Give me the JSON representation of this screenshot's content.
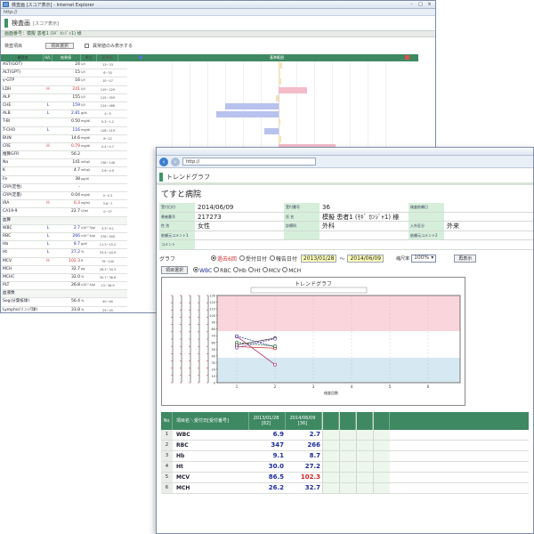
{
  "win1": {
    "title": "検査画 [スコア表示] - Internet Explorer",
    "address": "http://",
    "header_title": "検査画",
    "header_sub": "[スコア表示]",
    "patient_line": "画面番号：模擬 患者1 (ﾓｷﾞ ｶﾝｼﾞｬ1) 様",
    "filter_label": "検査項目",
    "filter_button": "項目選択",
    "checkbox_label": "異常値のみ表示する",
    "columns": [
      "項目名",
      "H/L",
      "結果値",
      "単位",
      "基準値"
    ],
    "scale_label": "基準範囲",
    "rows": [
      {
        "name": "AST(GOT)",
        "hl": "",
        "val": "24",
        "unit": "U/l",
        "ref": "13~33"
      },
      {
        "name": "ALT(GPT)",
        "hl": "",
        "val": "15",
        "unit": "U/l",
        "ref": "6~30"
      },
      {
        "name": "γ-GTP",
        "hl": "",
        "val": "16",
        "unit": "U/l",
        "ref": "10~47"
      },
      {
        "name": "LDH",
        "hl": "H",
        "val": "241",
        "unit": "U/l",
        "ref": "119~229"
      },
      {
        "name": "ALP",
        "hl": "",
        "val": "155",
        "unit": "U/l",
        "ref": "115~359"
      },
      {
        "name": "CHE",
        "hl": "L",
        "val": "159",
        "unit": "U/l",
        "ref": "214~466"
      },
      {
        "name": "ALB",
        "hl": "L",
        "val": "2.81",
        "unit": "g/dl",
        "ref": "4~5"
      },
      {
        "name": "T-BI",
        "hl": "",
        "val": "0.50",
        "unit": "mg/dl",
        "ref": "0.3~1.2"
      },
      {
        "name": "T-CHO",
        "hl": "L",
        "val": "116",
        "unit": "mg/dl",
        "ref": "128~219"
      },
      {
        "name": "BUN",
        "hl": "",
        "val": "14.6",
        "unit": "mg/dl",
        "ref": "8~22"
      },
      {
        "name": "CRE",
        "hl": "H",
        "val": "0.79",
        "unit": "mg/dl",
        "ref": "0.4~0.7"
      },
      {
        "name": "推算GFR",
        "hl": "",
        "val": "56.2",
        "unit": "",
        "ref": ""
      },
      {
        "name": "Na",
        "hl": "",
        "val": "141",
        "unit": "mEq/l",
        "ref": "138~146"
      },
      {
        "name": "K",
        "hl": "",
        "val": "4.7",
        "unit": "mEq/l",
        "ref": "3.6~4.9"
      },
      {
        "name": "Fe",
        "hl": "",
        "val": "38",
        "unit": "μg/dl",
        "ref": ""
      },
      {
        "name": "CRP(定性)",
        "hl": "",
        "val": "-",
        "unit": "",
        "ref": ""
      },
      {
        "name": "CRP(定量)",
        "hl": "",
        "val": "0.04",
        "unit": "mg/dl",
        "ref": "0~0.3"
      },
      {
        "name": "IRA",
        "hl": "H",
        "val": "6.3",
        "unit": "ng/ml",
        "ref": "3.6~7"
      },
      {
        "name": "CA19-9",
        "hl": "",
        "val": "22.7",
        "unit": "U/ml",
        "ref": "0~37"
      },
      {
        "name": "血算",
        "hl": "",
        "val": "",
        "unit": "",
        "ref": "",
        "section": true
      },
      {
        "name": "WBC",
        "hl": "L",
        "val": "2.7",
        "unit": "x10^3/μl",
        "ref": "3.3~9.1"
      },
      {
        "name": "RBC",
        "hl": "L",
        "val": "266",
        "unit": "x10^4/μl",
        "ref": "376~500"
      },
      {
        "name": "Hb",
        "hl": "L",
        "val": "8.7",
        "unit": "g/dl",
        "ref": "11.3~15.2"
      },
      {
        "name": "Ht",
        "hl": "L",
        "val": "27.2",
        "unit": "%",
        "ref": "33.4~44.9"
      },
      {
        "name": "MCV",
        "hl": "H",
        "val": "102.3",
        "unit": "fl",
        "ref": "79~100"
      },
      {
        "name": "MCH",
        "hl": "",
        "val": "32.7",
        "unit": "pg",
        "ref": "26.3~34.3"
      },
      {
        "name": "MCHC",
        "hl": "",
        "val": "32.0",
        "unit": "%",
        "ref": "30.7~36.6"
      },
      {
        "name": "PLT",
        "hl": "",
        "val": "26.8",
        "unit": "x10^4/μl",
        "ref": "13~36.9"
      },
      {
        "name": "血液像",
        "hl": "",
        "val": "",
        "unit": "",
        "ref": "",
        "section": true
      },
      {
        "name": "Seg(分葉核球)",
        "hl": "",
        "val": "56.4",
        "unit": "%",
        "ref": "40~60"
      },
      {
        "name": "Lympho(リンパ球)",
        "hl": "",
        "val": "33.8",
        "unit": "%",
        "ref": "25~45"
      }
    ],
    "score_bars": [
      {
        "row": 0,
        "score": 0.2,
        "color": "#f5e3b8"
      },
      {
        "row": 1,
        "score": 0.1,
        "color": "#f5e3b8"
      },
      {
        "row": 2,
        "score": 0.15,
        "color": "#f5e3b8"
      },
      {
        "row": 3,
        "score": 1.6,
        "color": "#f4bcc8"
      },
      {
        "row": 4,
        "score": -0.15,
        "color": "#f5e3b8"
      },
      {
        "row": 5,
        "score": -3.0,
        "color": "#b8c2ee"
      },
      {
        "row": 6,
        "score": -3.5,
        "color": "#b8c2ee"
      },
      {
        "row": 7,
        "score": 0.05,
        "color": "#f5e3b8"
      },
      {
        "row": 8,
        "score": -0.8,
        "color": "#b8c2ee"
      },
      {
        "row": 9,
        "score": 0.15,
        "color": "#f5e3b8"
      },
      {
        "row": 10,
        "score": 3.2,
        "color": "#f4bcc8"
      }
    ]
  },
  "win2": {
    "address": "http://",
    "header_title": "トレンドグラフ",
    "hospital": "てすと病院",
    "info": [
      [
        {
          "l": "受付日付",
          "v": "2014/06/09",
          "w": 40,
          "vw": 100
        },
        {
          "l": "受付番号",
          "v": "36",
          "w": 40,
          "vw": 100
        },
        {
          "l": "検査依頼日",
          "v": "",
          "w": 40,
          "vw": 100
        }
      ],
      [
        {
          "l": "患者番号",
          "v": "217273",
          "w": 40,
          "vw": 100
        },
        {
          "l": "氏 名",
          "v": "模擬 患者1 (ﾓｷﾞ ｶﾝｼﾞｬ1) 様",
          "w": 40,
          "vw": 100
        },
        {
          "l": "",
          "v": "",
          "w": 40,
          "vw": 100
        }
      ],
      [
        {
          "l": "性 別",
          "v": "女性",
          "w": 40,
          "vw": 100
        },
        {
          "l": "診療科",
          "v": "外科",
          "w": 40,
          "vw": 100
        },
        {
          "l": "入外区分",
          "v": "外来",
          "w": 40,
          "vw": 100
        }
      ],
      [
        {
          "l": "依頼元コメント1",
          "v": "",
          "w": 40,
          "vw": 100
        },
        {
          "l": "",
          "v": "",
          "w": 40,
          "vw": 100
        },
        {
          "l": "依頼元コメント2",
          "v": "",
          "w": 40,
          "vw": 100
        }
      ],
      [
        {
          "l": "コメント",
          "v": "",
          "w": 40,
          "vw": 380
        }
      ]
    ],
    "graph_label": "グラフ",
    "radios": [
      {
        "label": "過去6回",
        "on": true
      },
      {
        "label": "受付日付",
        "on": false
      },
      {
        "label": "報告日付",
        "on": false
      }
    ],
    "date_from": "2013/01/28",
    "date_tilde": "～",
    "date_to": "2014/06/09",
    "scale_label": "縮尺率",
    "scale_value": "100%",
    "redisplay_button": "再表示",
    "item_button": "項目選択",
    "items": [
      {
        "label": "WBC",
        "on": true
      },
      {
        "label": "RBC",
        "on": false
      },
      {
        "label": "Hb",
        "on": false
      },
      {
        "label": "Ht",
        "on": false
      },
      {
        "label": "MCV",
        "on": false
      },
      {
        "label": "MCH",
        "on": false
      }
    ],
    "graph_title": "トレンドグラフ",
    "graph_xlabel": "検査回数",
    "graph_ticks_x": [
      "1",
      "2",
      "3",
      "4",
      "5",
      "6"
    ],
    "graph_ticks_y": [
      "130",
      "120",
      "110",
      "100",
      "90",
      "80",
      "70",
      "60",
      "50",
      "40",
      "30",
      "20",
      "10",
      "0"
    ],
    "table_headers": {
      "no": "No",
      "name": "項目名＼受付日[受付番号]",
      "d1": "2013/01/28",
      "n1": "[82]",
      "d2": "2014/06/09",
      "n2": "[36]"
    },
    "table_rows": [
      {
        "no": "1",
        "name": "WBC",
        "v1": "6.9",
        "v2": "2.7",
        "v2red": false
      },
      {
        "no": "2",
        "name": "RBC",
        "v1": "347",
        "v2": "266",
        "v2red": false
      },
      {
        "no": "3",
        "name": "Hb",
        "v1": "9.1",
        "v2": "8.7",
        "v2red": false
      },
      {
        "no": "4",
        "name": "Ht",
        "v1": "30.0",
        "v2": "27.2",
        "v2red": false
      },
      {
        "no": "5",
        "name": "MCV",
        "v1": "86.5",
        "v2": "102.3",
        "v2red": true
      },
      {
        "no": "6",
        "name": "MCH",
        "v1": "26.2",
        "v2": "32.7",
        "v2red": false
      }
    ]
  },
  "chart_data": {
    "type": "line",
    "x": [
      1,
      2
    ],
    "xlabel": "検査回数",
    "title": "トレンドグラフ",
    "series": [
      {
        "name": "WBC",
        "values": [
          6.9,
          2.7
        ],
        "color": "#b02a6a"
      },
      {
        "name": "RBC",
        "values": [
          347,
          266
        ],
        "color": "#2d3a9c"
      },
      {
        "name": "Hb",
        "values": [
          9.1,
          8.7
        ],
        "color": "#d03030"
      },
      {
        "name": "Ht",
        "values": [
          30.0,
          27.2
        ],
        "color": "#2b6c3a"
      },
      {
        "name": "MCV",
        "values": [
          86.5,
          102.3
        ],
        "color": "#444"
      },
      {
        "name": "MCH",
        "values": [
          26.2,
          32.7
        ],
        "color": "#7a4ab0"
      }
    ]
  }
}
